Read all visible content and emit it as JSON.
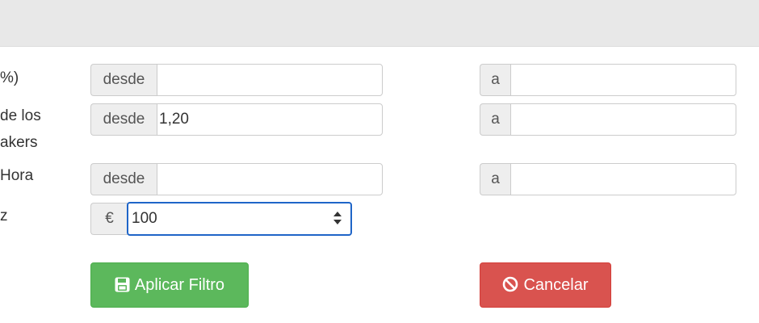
{
  "header": {},
  "rows": {
    "percent": {
      "label": "%)",
      "from_addon": "desde",
      "from_value": "",
      "to_addon": "a",
      "to_value": ""
    },
    "makers": {
      "label_line1": "de los",
      "label_line2": "akers",
      "from_addon": "desde",
      "from_value": "1,20",
      "to_addon": "a",
      "to_value": ""
    },
    "hora": {
      "label": "Hora",
      "from_addon": "desde",
      "from_value": "",
      "to_addon": "a",
      "to_value": ""
    },
    "amount": {
      "label": "z",
      "currency_addon": "€",
      "value": "100"
    }
  },
  "buttons": {
    "apply_label": "Aplicar Filtro",
    "apply_icon": "floppy-disk-icon",
    "cancel_label": "Cancelar",
    "cancel_icon": "ban-icon"
  },
  "colors": {
    "apply": "#5cb85c",
    "cancel": "#d9534f",
    "focus": "#1f65c8",
    "header": "#e8e8e8"
  }
}
